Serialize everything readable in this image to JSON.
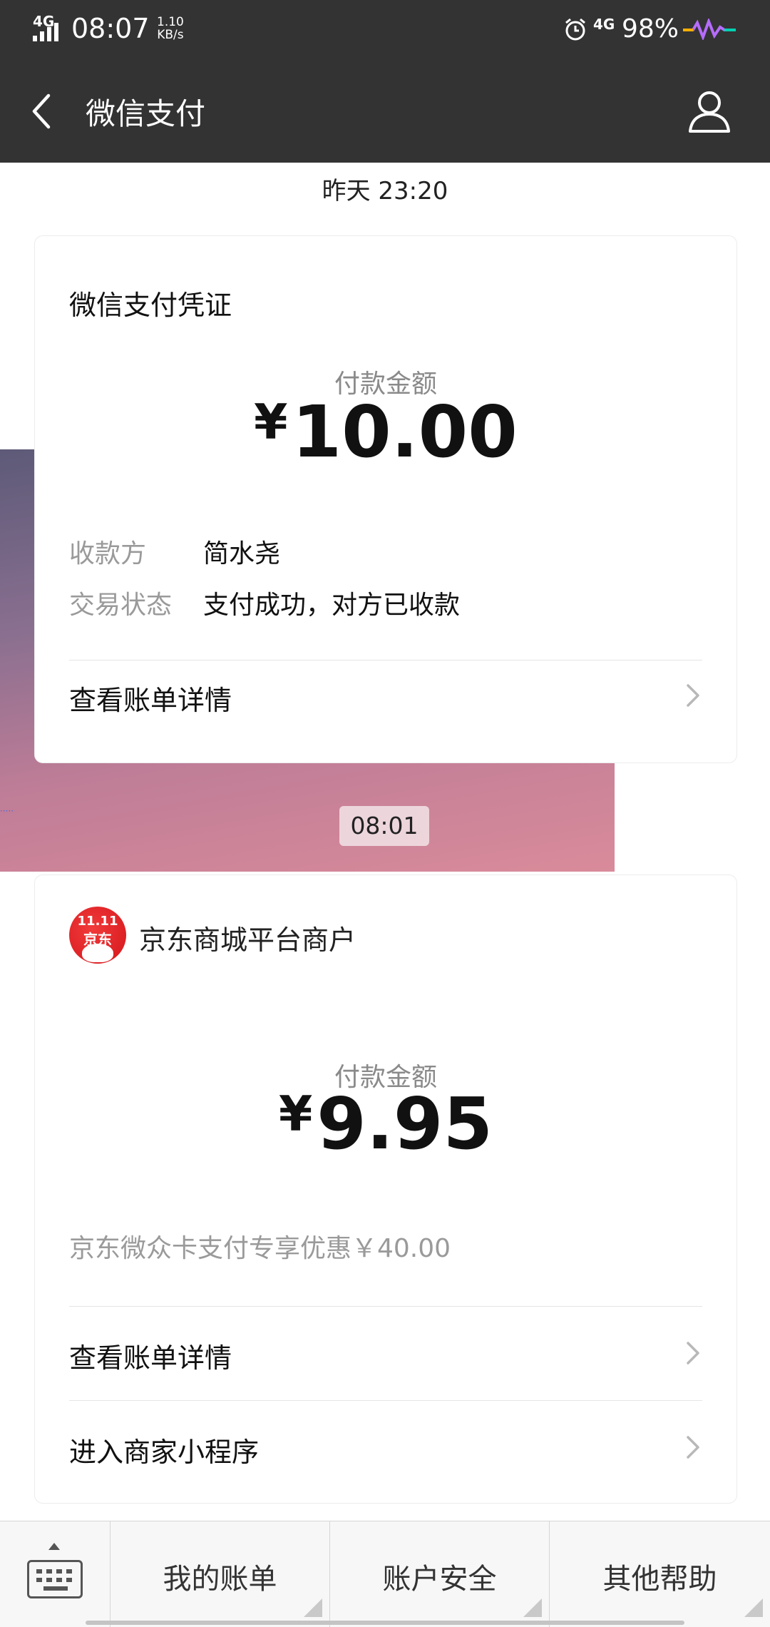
{
  "status_bar": {
    "network": "4G",
    "time": "08:07",
    "speed_value": "1.10",
    "speed_unit": "KB/s",
    "network_right": "4G",
    "battery": "98%"
  },
  "nav": {
    "title": "微信支付",
    "back_icon": "back-arrow-icon",
    "profile_icon": "profile-icon"
  },
  "timeline": {
    "stamp1": "昨天 23:20",
    "stamp2": "08:01"
  },
  "card1": {
    "title": "微信支付凭证",
    "amount_label": "付款金额",
    "currency": "¥",
    "amount": "10.00",
    "fields": [
      {
        "label": "收款方",
        "value": "简水尧"
      },
      {
        "label": "交易状态",
        "value": "支付成功，对方已收款"
      }
    ],
    "link_label": "查看账单详情"
  },
  "card2": {
    "merchant_name": "京东商城平台商户",
    "logo_top": "11.11",
    "logo_text": "京东",
    "amount_label": "付款金额",
    "currency": "¥",
    "amount": "9.95",
    "promo": "京东微众卡支付专享优惠￥40.00",
    "link1_label": "查看账单详情",
    "link2_label": "进入商家小程序"
  },
  "bottom_bar": {
    "menu1": "我的账单",
    "menu2": "账户安全",
    "menu3": "其他帮助"
  },
  "colors": {
    "header_bg": "#333333",
    "background": "#ffffff"
  }
}
